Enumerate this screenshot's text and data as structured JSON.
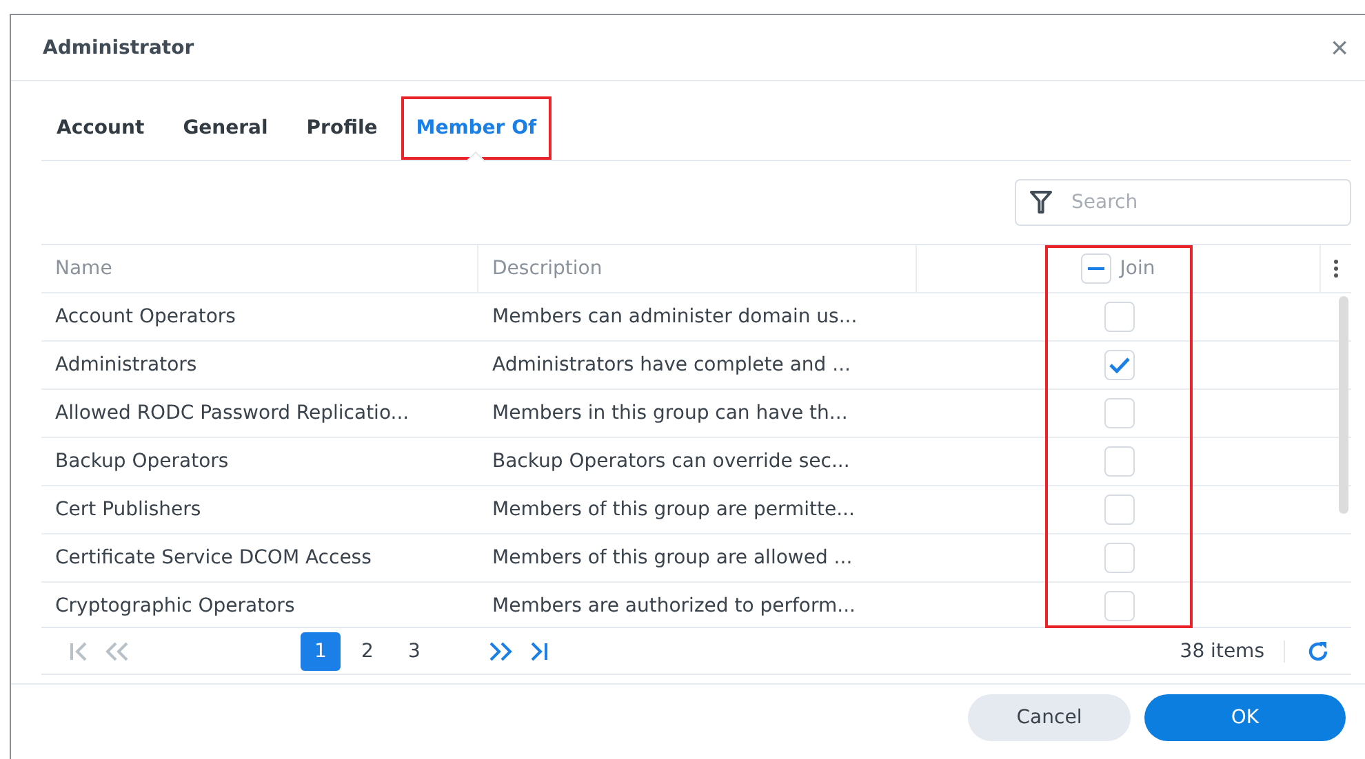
{
  "window": {
    "title": "Administrator",
    "close": "×"
  },
  "tabs": [
    {
      "label": "Account",
      "selected": false,
      "highlighted": false
    },
    {
      "label": "General",
      "selected": false,
      "highlighted": false
    },
    {
      "label": "Profile",
      "selected": false,
      "highlighted": false
    },
    {
      "label": "Member Of",
      "selected": true,
      "highlighted": true
    }
  ],
  "search": {
    "placeholder": "Search"
  },
  "table": {
    "columns": [
      {
        "label": "Name"
      },
      {
        "label": "Description"
      },
      {
        "label": "Join",
        "kind": "checkbox",
        "indeterminate": true,
        "highlighted": true
      }
    ],
    "rows": [
      {
        "name": "Account Operators",
        "description": "Members can administer domain us...",
        "checked": false
      },
      {
        "name": "Administrators",
        "description": "Administrators have complete and ...",
        "checked": true
      },
      {
        "name": "Allowed RODC Password Replicatio...",
        "description": "Members in this group can have th...",
        "checked": false
      },
      {
        "name": "Backup Operators",
        "description": "Backup Operators can override sec...",
        "checked": false
      },
      {
        "name": "Cert Publishers",
        "description": "Members of this group are permitte...",
        "checked": false
      },
      {
        "name": "Certificate Service DCOM Access",
        "description": "Members of this group are allowed ...",
        "checked": false
      },
      {
        "name": "Cryptographic Operators",
        "description": "Members are authorized to perform...",
        "checked": false
      }
    ]
  },
  "pager": {
    "pages": [
      {
        "label": "1",
        "selected": true
      },
      {
        "label": "2",
        "selected": false
      },
      {
        "label": "3",
        "selected": false
      }
    ],
    "count": "38 items"
  },
  "buttons": [
    {
      "label": "Cancel",
      "kind": "secondary"
    },
    {
      "label": "OK",
      "kind": "primary"
    }
  ]
}
